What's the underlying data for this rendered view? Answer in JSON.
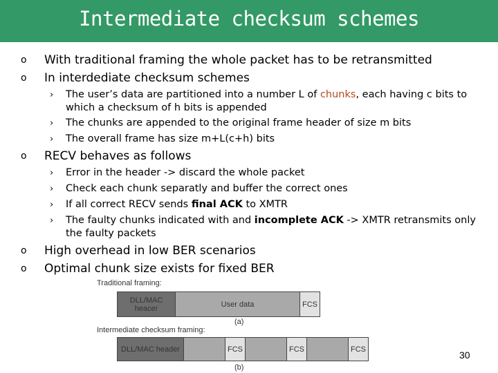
{
  "title": "Intermediate checksum schemes",
  "bullets": {
    "b1": "With traditional framing the whole packet has to be retransmitted",
    "b2": "In interdediate checksum schemes",
    "b2_sub1_pre": "The user’s data are partitioned into a number L of ",
    "b2_sub1_hl": "chunks",
    "b2_sub1_post": ", each having c bits to which a checksum of h bits is appended",
    "b2_sub2": "The chunks are appended to the original frame header of size m bits",
    "b2_sub3": "The overall frame has size  m+L(c+h) bits",
    "b3": "RECV behaves as follows",
    "b3_sub1": "Error in the header -> discard the whole packet",
    "b3_sub2": "Check each chunk separatly and buffer the correct ones",
    "b3_sub3_pre": "If all correct RECV sends ",
    "b3_sub3_bold": "final  ACK",
    "b3_sub3_post": " to XMTR",
    "b3_sub4_pre": "The faulty chunks indicated with and ",
    "b3_sub4_bold": "incomplete  ACK",
    "b3_sub4_post": " -> XMTR retransmits only the faulty packets",
    "b4": "High overhead in low BER scenarios",
    "b5": "Optimal chunk size exists for fixed BER",
    "bullet_l1": "o",
    "bullet_l2": "›"
  },
  "diagram": {
    "traditional_label": "Traditional framing:",
    "a_header": "DLL/MAC heacer",
    "a_data": "User data",
    "a_fcs": "FCS",
    "a_caption": "(a)",
    "intermediate_label": "Intermediate checksum framing:",
    "b_header": "DLL/MAC header",
    "b_fcs": "FCS",
    "b_caption": "(b)"
  },
  "page_number": "30",
  "colors": {
    "title_bg": "#339966",
    "highlight": "#b04a1e"
  }
}
